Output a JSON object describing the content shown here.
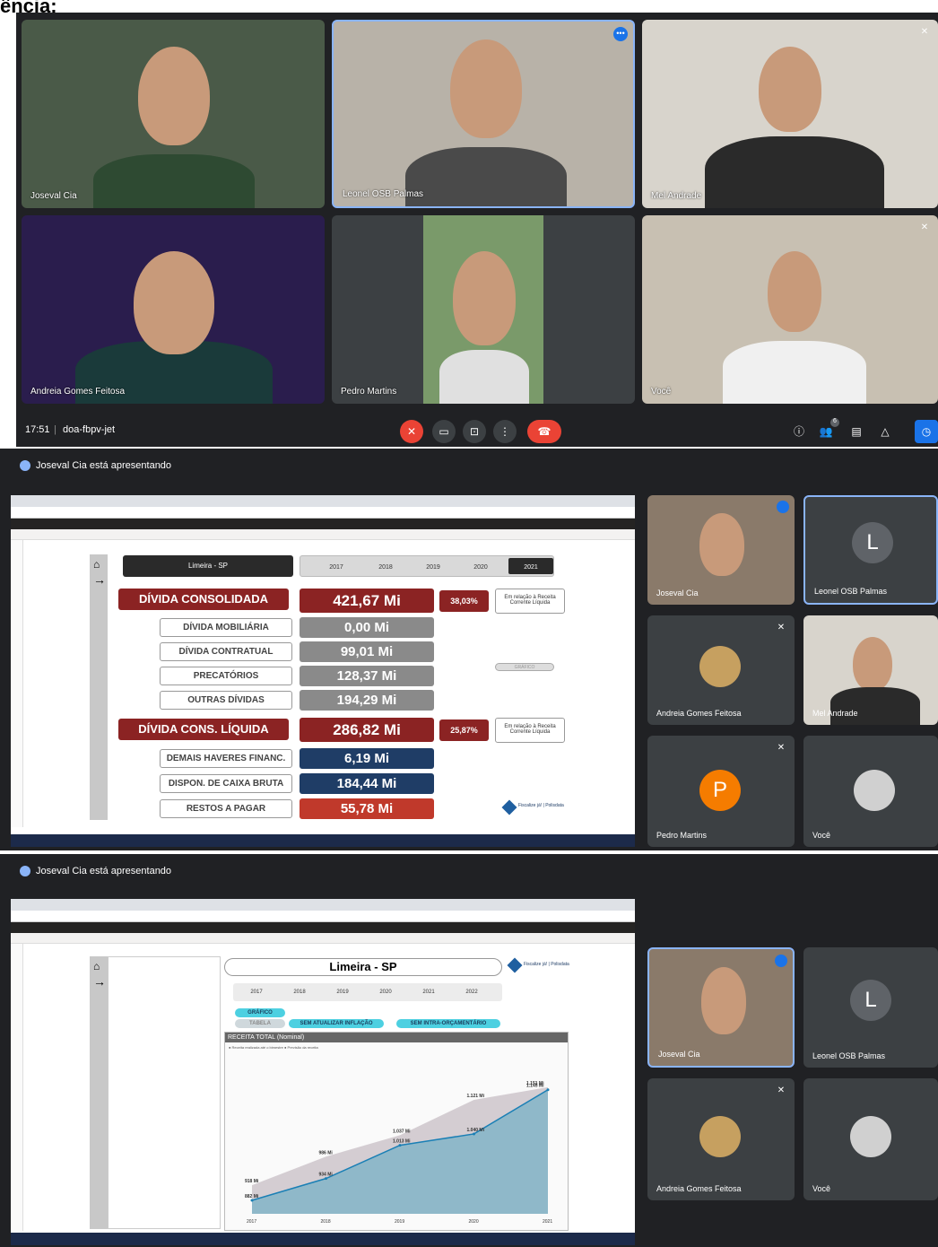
{
  "page_heading": "ência:",
  "meeting": {
    "time": "17:51",
    "code": "doa-fbpv-jet",
    "people_count": "6",
    "tiles": [
      {
        "name": "Joseval Cia"
      },
      {
        "name": "Leonel OSB Palmas"
      },
      {
        "name": "Mel Andrade"
      },
      {
        "name": "Andreia Gomes Feitosa"
      },
      {
        "name": "Pedro Martins"
      },
      {
        "name": "Você"
      }
    ]
  },
  "presentation1": {
    "banner": "Joseval Cia está apresentando",
    "report": {
      "city": "Limeira - SP",
      "years": [
        "2017",
        "2018",
        "2019",
        "2020",
        "2021"
      ],
      "selected_year": "2021",
      "rows": [
        {
          "label": "DÍVIDA CONSOLIDADA",
          "value": "421,67 Mi",
          "kind": "main"
        },
        {
          "label": "DÍVIDA MOBILIÁRIA",
          "value": "0,00 Mi",
          "kind": "sub"
        },
        {
          "label": "DÍVIDA CONTRATUAL",
          "value": "99,01 Mi",
          "kind": "sub"
        },
        {
          "label": "PRECATÓRIOS",
          "value": "128,37 Mi",
          "kind": "sub"
        },
        {
          "label": "OUTRAS DÍVIDAS",
          "value": "194,29 Mi",
          "kind": "sub"
        },
        {
          "label": "DÍVIDA CONS. LÍQUIDA",
          "value": "286,82 Mi",
          "kind": "main"
        },
        {
          "label": "DEMAIS HAVERES FINANC.",
          "value": "6,19 Mi",
          "kind": "blue"
        },
        {
          "label": "DISPON. DE CAIXA BRUTA",
          "value": "184,44 Mi",
          "kind": "blue"
        },
        {
          "label": "RESTOS A PAGAR",
          "value": "55,78 Mi",
          "kind": "red"
        }
      ],
      "pct1": "38,03%",
      "pct2": "25,87%",
      "note": "Em relação à Receita Corrente Líquida",
      "grafico_btn": "GRÁFICO",
      "logo_text": "Fiscalize já! | Polisdata"
    },
    "participants": [
      {
        "name": "Joseval Cia"
      },
      {
        "name": "Leonel OSB Palmas",
        "initial": "L"
      },
      {
        "name": "Andreia Gomes Feitosa"
      },
      {
        "name": "Mel Andrade"
      },
      {
        "name": "Pedro Martins",
        "initial": "P"
      },
      {
        "name": "Você"
      }
    ]
  },
  "presentation2": {
    "banner": "Joseval Cia está apresentando",
    "report": {
      "city": "Limeira - SP",
      "years": [
        "2017",
        "2018",
        "2019",
        "2020",
        "2021",
        "2022"
      ],
      "grafico": "GRÁFICO",
      "tabela": "TABELA",
      "chip1": "SEM ATUALIZAR INFLAÇÃO",
      "chip2": "SEM INTRA-ORÇAMENTÁRIO",
      "chart_title": "RECEITA TOTAL (Nominal)",
      "legend": "● Receita realizada até o bimestre  ● Previsão da receita",
      "logo_text": "Fiscalize já! | Polisdata"
    },
    "participants": [
      {
        "name": "Joseval Cia"
      },
      {
        "name": "Leonel OSB Palmas",
        "initial": "L"
      },
      {
        "name": "Andreia Gomes Feitosa"
      },
      {
        "name": "Você"
      }
    ]
  },
  "chart_data": {
    "type": "area",
    "title": "RECEITA TOTAL (Nominal)",
    "categories": [
      "2017",
      "2018",
      "2019",
      "2020",
      "2021"
    ],
    "series": [
      {
        "name": "Previsão da receita",
        "values": [
          918,
          986,
          1037,
          1121,
          1151
        ]
      },
      {
        "name": "Receita realizada até o bimestre",
        "values": [
          882,
          934,
          1013,
          1040,
          1145
        ]
      }
    ],
    "value_labels": [
      [
        "918 Mi",
        "986 Mi",
        "1.037 Mi",
        "1.121 Mi",
        "1.151 Mi"
      ],
      [
        "882 Mi",
        "934 Mi",
        "1.013 Mi",
        "1.040 Mi",
        "1.145 Mi"
      ]
    ],
    "colors": {
      "forecast": "#d4cdd2",
      "realized": "#8fb8c9",
      "line": "#1a7fb5"
    }
  }
}
